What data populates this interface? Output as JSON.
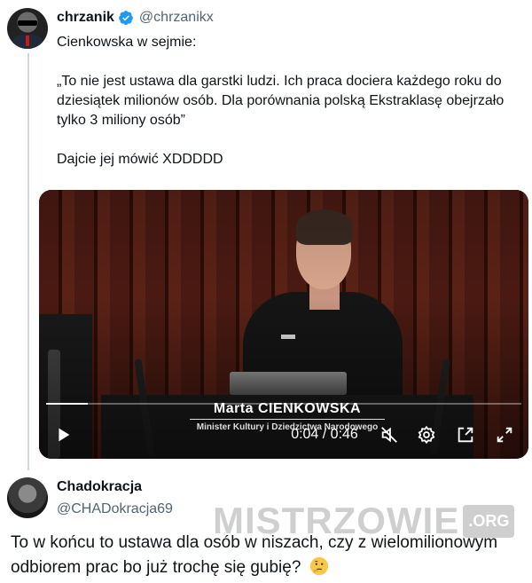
{
  "tweet": {
    "author_name": "chrzanik",
    "author_handle": "@chrzanikx",
    "text": "Cienkowska w sejmie:\n\n„To nie jest ustawa dla garstki ludzi. Ich praca dociera każdego roku do dziesiątek milionów osób. Dla porównania polską Ekstraklasę obejrzało tylko 3 miliony osób”\n\nDajcie jej mówić XDDDDD",
    "verified_color": "#1d9bf0"
  },
  "video": {
    "caption_name": "Marta CIENKOWSKA",
    "caption_role": "Minister Kultury i Dziedzictwa Narodowego",
    "time": "0:04 / 0:46",
    "progress": 0.087,
    "icons": [
      "play-icon",
      "mute-icon",
      "settings-icon",
      "pip-icon",
      "fullscreen-icon"
    ]
  },
  "reply": {
    "author_name": "Chadokracja",
    "author_handle": "@CHADokracja69",
    "text": "To w końcu to ustawa dla osób w niszach, czy z wielomilionowym odbiorem prac bo już trochę się gubię?",
    "emoji": "thinking-face-icon"
  },
  "watermark": {
    "text": "MISTRZOWIE",
    "suffix": ".ORG"
  }
}
